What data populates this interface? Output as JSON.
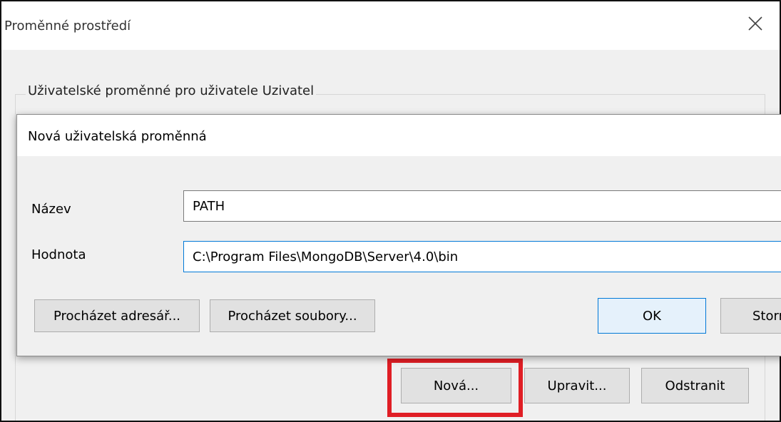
{
  "window": {
    "title": "Proměnné prostředí",
    "close_icon": "close-icon"
  },
  "user_vars_group": {
    "label": "Uživatelské proměnné pro uživatele Uzivatel",
    "buttons": {
      "new": "Nová...",
      "edit": "Upravit...",
      "delete": "Odstranit"
    },
    "highlight_color": "#e01e25"
  },
  "dialog": {
    "title": "Nová uživatelská proměnná",
    "name_label": "Název",
    "name_value": "PATH",
    "value_label": "Hodnota",
    "value_value": "C:\\Program Files\\MongoDB\\Server\\4.0\\bin",
    "browse_dir_button": "Procházet adresář...",
    "browse_files_button": "Procházet soubory...",
    "ok_button": "OK",
    "cancel_button": "Storno",
    "accent_color": "#0078d7"
  }
}
